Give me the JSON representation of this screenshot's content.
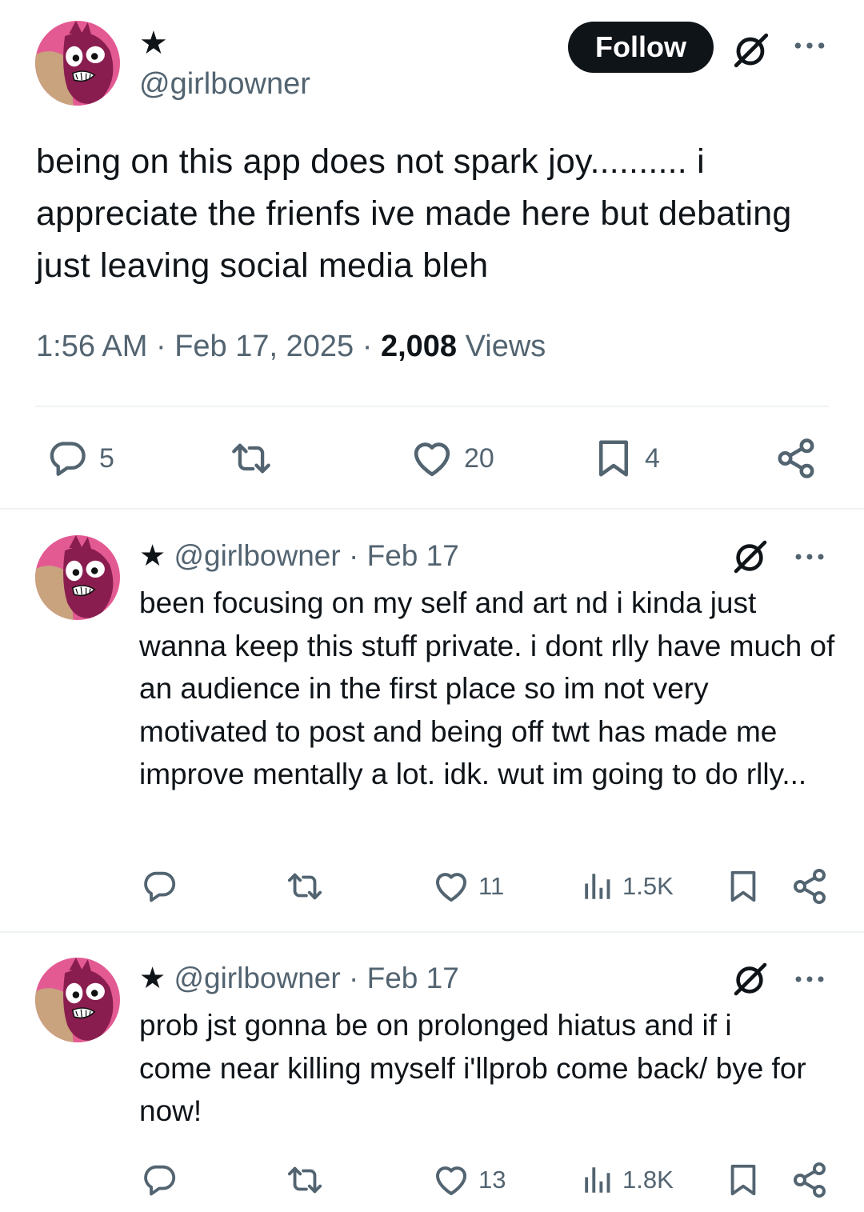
{
  "main_tweet": {
    "display_name": "★",
    "handle": "@girlbowner",
    "follow_label": "Follow",
    "text": "being on this app does not spark joy.......... i appreciate the frienfs ive made here but debating just leaving social media bleh",
    "time": "1:56 AM",
    "sep1": "·",
    "date": "Feb 17, 2025",
    "sep2": "·",
    "views_count": "2,008",
    "views_label": "Views",
    "replies": "5",
    "likes": "20",
    "bookmarks": "4"
  },
  "replies": [
    {
      "star": "★",
      "handle": "@girlbowner",
      "sep": "·",
      "date": "Feb 17",
      "text": "been focusing on my self and art nd i kinda just wanna keep this stuff private. i dont rlly have much of an audience in the first place so im not very motivated to post and being off twt has made me improve mentally a lot. idk. wut im going to do rlly...",
      "likes": "11",
      "views": "1.5K"
    },
    {
      "star": "★",
      "handle": "@girlbowner",
      "sep": "·",
      "date": "Feb 17",
      "text": "prob jst gonna be on prolonged hiatus and if i come near killing myself i'llprob come back/ bye for now!",
      "likes": "13",
      "views": "1.8K"
    }
  ],
  "colors": {
    "text": "#0f1419",
    "muted": "#536471",
    "divider": "#eff3f4",
    "avatar_ring": "#e0558e",
    "avatar_creature": "#8a1d4f"
  },
  "icons": [
    "grok-icon",
    "more-icon",
    "reply-icon",
    "retweet-icon",
    "like-icon",
    "bookmark-icon",
    "share-icon",
    "views-icon"
  ]
}
